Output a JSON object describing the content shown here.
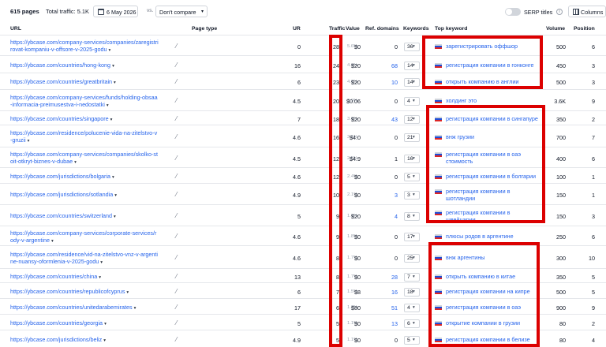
{
  "toolbar": {
    "pages_count": "615 pages",
    "total_traffic": "Total traffic: 5.1K",
    "date": "6 May 2026",
    "vs": "vs.",
    "compare": "Don't compare",
    "serp_titles": "SERP titles",
    "columns": "Columns"
  },
  "headers": {
    "url": "URL",
    "page_type": "Page type",
    "ur": "UR",
    "traffic": "Traffic",
    "value": "Value",
    "ref_domains": "Ref. domains",
    "keywords": "Keywords",
    "top_keyword": "Top keyword",
    "volume": "Volume",
    "position": "Position"
  },
  "colors": {
    "highlight": "#dc0000",
    "link": "#2563eb",
    "flag": [
      "#ffffff",
      "#1d4ed8",
      "#dc2626"
    ]
  },
  "rows": [
    {
      "url": [
        "https://ybcase.com/company-services/companies/zaregistri",
        "rovat-kompaniu-v-offsore-v-2025-godu"
      ],
      "ur": "0",
      "traffic": "288",
      "pct": "5.6%",
      "value": "$0",
      "ref_domains": "0",
      "ref_link": false,
      "keywords": "36",
      "top_keyword": [
        "зарегистрировать оффшор"
      ],
      "volume": "500",
      "position": "6"
    },
    {
      "url": [
        "https://ybcase.com/countries/hong-kong"
      ],
      "ur": "16",
      "traffic": "249",
      "pct": "4.9%",
      "value": "$20",
      "ref_domains": "68",
      "ref_link": true,
      "keywords": "14",
      "top_keyword": [
        "регистрация компании в гонконге"
      ],
      "volume": "450",
      "position": "3"
    },
    {
      "url": [
        "https://ybcase.com/countries/greatbritain"
      ],
      "ur": "6",
      "traffic": "235",
      "pct": "4.6%",
      "value": "$20",
      "ref_domains": "10",
      "ref_link": true,
      "keywords": "14",
      "top_keyword": [
        "открыть компанию в англии"
      ],
      "volume": "500",
      "position": "3"
    },
    {
      "url": [
        "https://ybcase.com/company-services/funds/holding-obsaa",
        "-informacia-preimusestva-i-nedostatki"
      ],
      "ur": "4.5",
      "traffic": "201",
      "pct": "3.9%",
      "value": "$0.06",
      "ref_domains": "0",
      "ref_link": false,
      "keywords": "4",
      "top_keyword": [
        "холдинг это"
      ],
      "volume": "3.6K",
      "position": "9"
    },
    {
      "url": [
        "https://ybcase.com/countries/singapore"
      ],
      "ur": "7",
      "traffic": "182",
      "pct": "3.6%",
      "value": "$20",
      "ref_domains": "43",
      "ref_link": true,
      "keywords": "12",
      "top_keyword": [
        "регистрация компании в сингапуре"
      ],
      "volume": "350",
      "position": "2"
    },
    {
      "url": [
        "https://ybcase.com/residence/polucenie-vida-na-zitelstvo-v",
        "-gruzii"
      ],
      "ur": "4.6",
      "traffic": "160",
      "pct": "3.1%",
      "value": "$4.0",
      "ref_domains": "0",
      "ref_link": false,
      "keywords": "21",
      "top_keyword": [
        "внж грузии"
      ],
      "volume": "700",
      "position": "7"
    },
    {
      "url": [
        "https://ybcase.com/company-services/companies/skolko-st",
        "oit-otkryt-biznes-v-dubae"
      ],
      "ur": "4.5",
      "traffic": "127",
      "pct": "2.5%",
      "value": "$4.9",
      "ref_domains": "1",
      "ref_link": false,
      "keywords": "16",
      "top_keyword": [
        "регистрация компании в оаэ",
        "стоимость"
      ],
      "volume": "400",
      "position": "6"
    },
    {
      "url": [
        "https://ybcase.com/jurisdictions/bolgaria"
      ],
      "ur": "4.6",
      "traffic": "123",
      "pct": "2.4%",
      "value": "$0",
      "ref_domains": "0",
      "ref_link": false,
      "keywords": "5",
      "top_keyword": [
        "регистрация компании в болгарии"
      ],
      "volume": "100",
      "position": "1"
    },
    {
      "url": [
        "https://ybcase.com/jurisdictions/sotlandia"
      ],
      "ur": "4.9",
      "traffic": "108",
      "pct": "2.1%",
      "value": "$0",
      "ref_domains": "3",
      "ref_link": true,
      "keywords": "3",
      "top_keyword": [
        "регистрация компании в",
        "шотландии"
      ],
      "volume": "150",
      "position": "1"
    },
    {
      "url": [
        "https://ybcase.com/countries/switzerland"
      ],
      "ur": "5",
      "traffic": "96",
      "pct": "1.9%",
      "value": "$20",
      "ref_domains": "4",
      "ref_link": true,
      "keywords": "8",
      "top_keyword": [
        "регистрация компании в",
        "швейцарии"
      ],
      "volume": "150",
      "position": "3"
    },
    {
      "url": [
        "https://ybcase.com/company-services/corporate-services/r",
        "ody-v-argentine"
      ],
      "ur": "4.6",
      "traffic": "93",
      "pct": "1.8%",
      "value": "$0",
      "ref_domains": "0",
      "ref_link": false,
      "keywords": "17",
      "top_keyword": [
        "плюсы родов в аргентине"
      ],
      "volume": "250",
      "position": "6"
    },
    {
      "url": [
        "https://ybcase.com/residence/vid-na-zitelstvo-vnz-v-argenti",
        "ne-nuansy-oformlenia-v-2025-godu"
      ],
      "ur": "4.6",
      "traffic": "88",
      "pct": "1.7%",
      "value": "$0",
      "ref_domains": "0",
      "ref_link": false,
      "keywords": "25",
      "top_keyword": [
        "внж аргентины"
      ],
      "volume": "300",
      "position": "10"
    },
    {
      "url": [
        "https://ybcase.com/countries/china"
      ],
      "ur": "13",
      "traffic": "85",
      "pct": "1.7%",
      "value": "$0",
      "ref_domains": "28",
      "ref_link": true,
      "keywords": "7",
      "top_keyword": [
        "открыть компанию в китае"
      ],
      "volume": "350",
      "position": "5"
    },
    {
      "url": [
        "https://ybcase.com/countries/republicofcyprus"
      ],
      "ur": "6",
      "traffic": "77",
      "pct": "1.5%",
      "value": "$8",
      "ref_domains": "16",
      "ref_link": true,
      "keywords": "18",
      "top_keyword": [
        "регистрация компании на кипре"
      ],
      "volume": "500",
      "position": "5"
    },
    {
      "url": [
        "https://ybcase.com/countries/unitedarabemirates"
      ],
      "ur": "17",
      "traffic": "64",
      "pct": "1.3%",
      "value": "$80",
      "ref_domains": "51",
      "ref_link": true,
      "keywords": "4",
      "top_keyword": [
        "регистрация компании в оаэ"
      ],
      "volume": "900",
      "position": "9"
    },
    {
      "url": [
        "https://ybcase.com/countries/georgia"
      ],
      "ur": "5",
      "traffic": "58",
      "pct": "1.1%",
      "value": "$0",
      "ref_domains": "13",
      "ref_link": true,
      "keywords": "6",
      "top_keyword": [
        "открытие компании в грузии"
      ],
      "volume": "80",
      "position": "2"
    },
    {
      "url": [
        "https://ybcase.com/jurisdictions/beliz"
      ],
      "ur": "4.9",
      "traffic": "58",
      "pct": "1.1%",
      "value": "$0",
      "ref_domains": "0",
      "ref_link": false,
      "keywords": "5",
      "top_keyword": [
        "регистрация компании в белизе"
      ],
      "volume": "80",
      "position": "4"
    }
  ]
}
